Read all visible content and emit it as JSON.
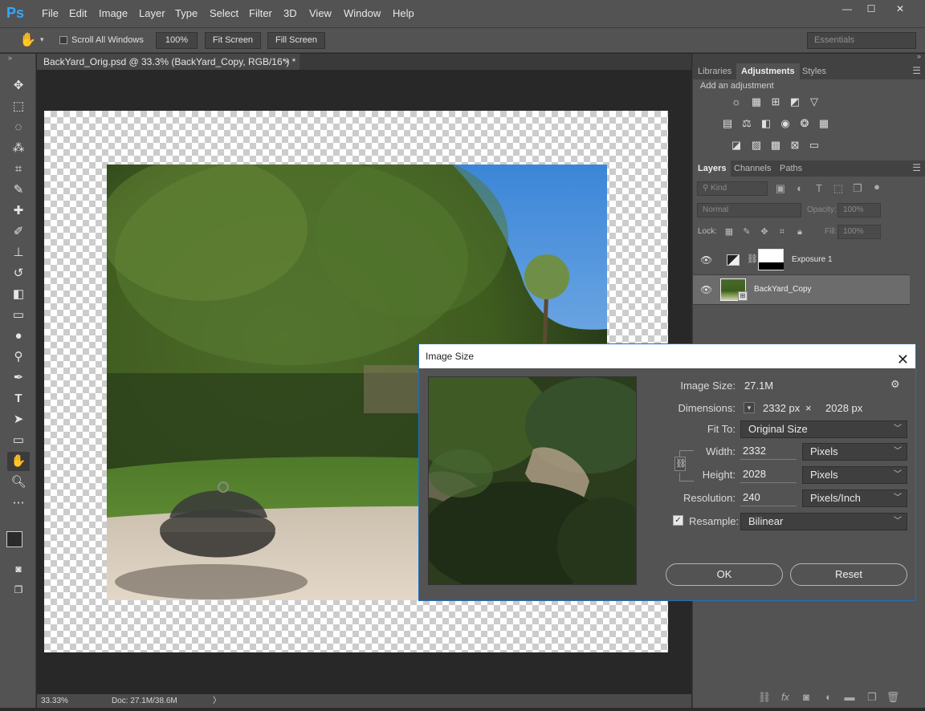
{
  "app": {
    "logo": "Ps"
  },
  "menubar": {
    "items": [
      "File",
      "Edit",
      "Image",
      "Layer",
      "Type",
      "Select",
      "Filter",
      "3D",
      "View",
      "Window",
      "Help"
    ]
  },
  "window_controls": {
    "minimize": "—",
    "maximize": "☐",
    "close": "✕"
  },
  "options_bar": {
    "scroll_all": "Scroll All Windows",
    "zoom_100": "100%",
    "fit_screen": "Fit Screen",
    "fill_screen": "Fill Screen",
    "workspace": "Essentials"
  },
  "document": {
    "tab_title": "BackYard_Orig.psd @ 33.3% (BackYard_Copy, RGB/16*) *",
    "tab_close": "×"
  },
  "statusbar": {
    "zoom": "33.33%",
    "doc": "Doc: 27.1M/38.6M",
    "arrow": "〉"
  },
  "right_panel": {
    "tabs": [
      "Libraries",
      "Adjustments",
      "Styles"
    ],
    "add_adjustment": "Add an adjustment",
    "layers_tabs": [
      "Layers",
      "Channels",
      "Paths"
    ],
    "kind": "Kind",
    "blend_mode": "Normal",
    "opacity_label": "Opacity:",
    "opacity_value": "100%",
    "lock_label": "Lock:",
    "fill_label": "Fill:",
    "fill_value": "100%",
    "layers": [
      {
        "name": "Exposure 1"
      },
      {
        "name": "BackYard_Copy"
      }
    ]
  },
  "dialog": {
    "title": "Image Size",
    "close": "✕",
    "image_size_label": "Image Size:",
    "image_size_value": "27.1M",
    "dimensions_label": "Dimensions:",
    "dim_w": "2332 px",
    "dim_x": "×",
    "dim_h": "2028 px",
    "fit_to_label": "Fit To:",
    "fit_to_value": "Original Size",
    "width_label": "Width:",
    "width_value": "2332",
    "width_unit": "Pixels",
    "height_label": "Height:",
    "height_value": "2028",
    "height_unit": "Pixels",
    "resolution_label": "Resolution:",
    "resolution_value": "240",
    "resolution_unit": "Pixels/Inch",
    "resample_label": "Resample:",
    "resample_value": "Bilinear",
    "ok": "OK",
    "reset": "Reset"
  }
}
